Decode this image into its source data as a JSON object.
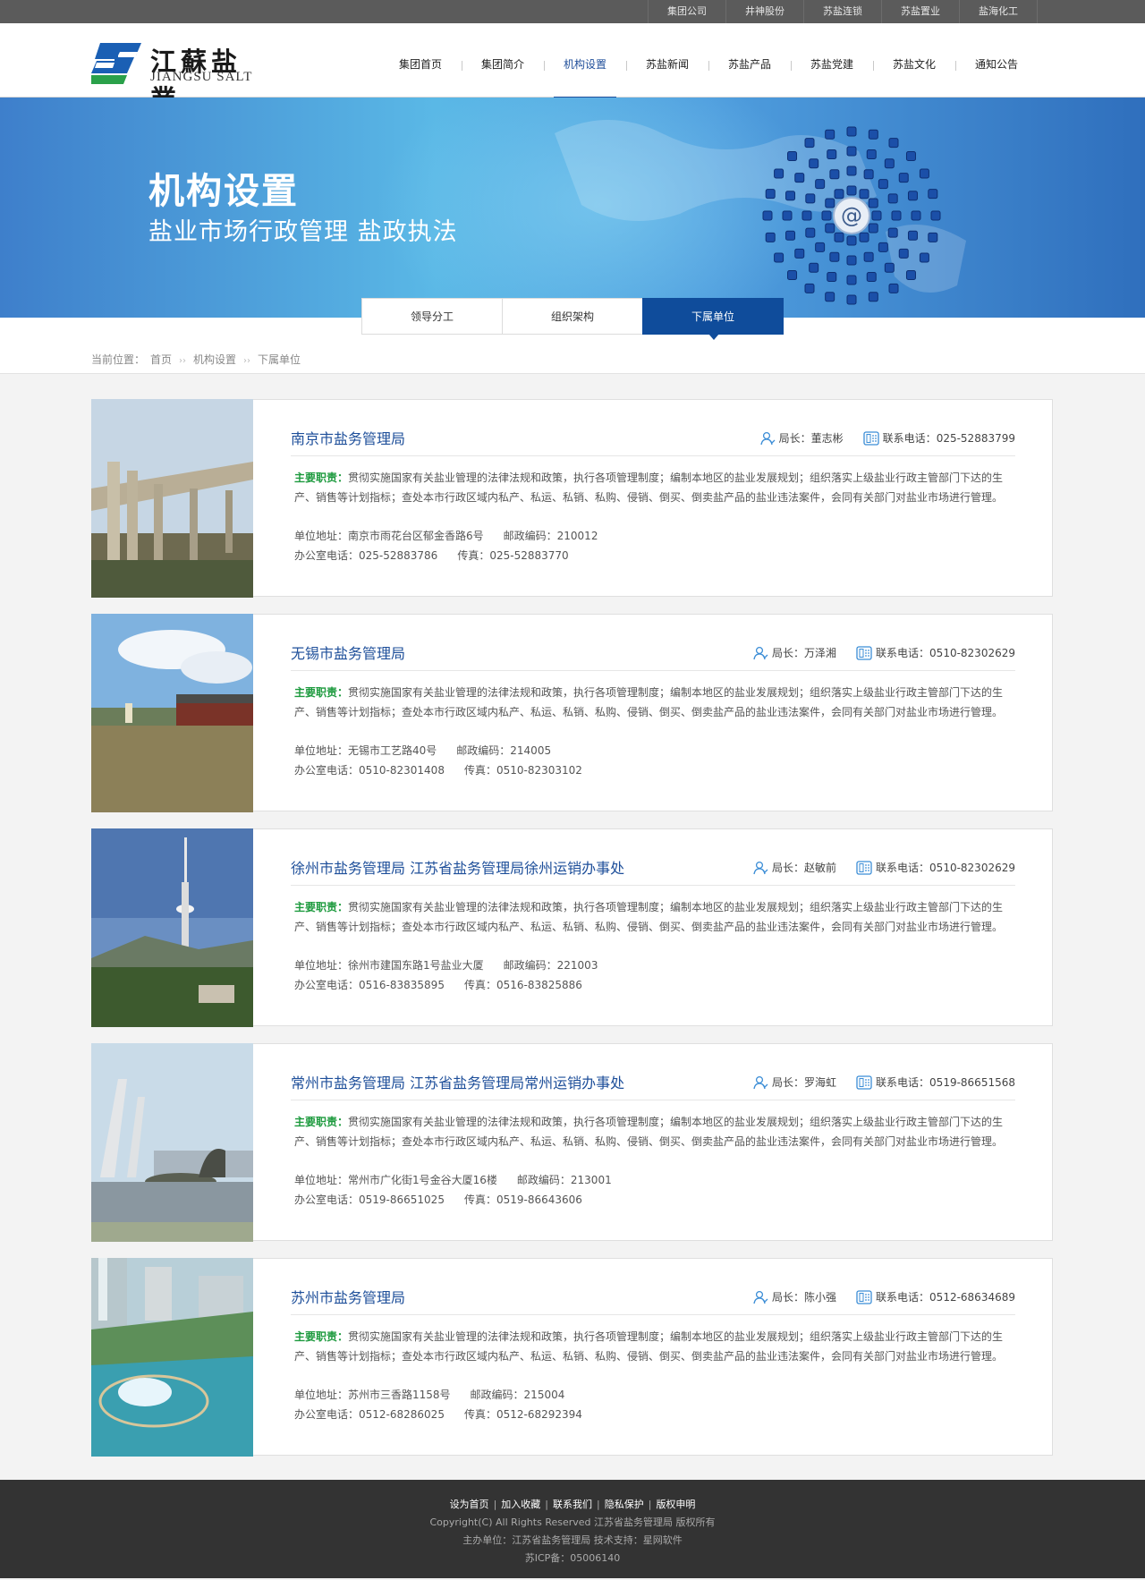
{
  "topbar": {
    "links": [
      "集团公司",
      "井神股份",
      "苏盐连锁",
      "苏盐置业",
      "盐海化工"
    ]
  },
  "logo": {
    "cn": "江蘇盐業",
    "en": "JIANGSU SALT"
  },
  "nav": {
    "items": [
      "集团首页",
      "集团简介",
      "机构设置",
      "苏盐新闻",
      "苏盐产品",
      "苏盐党建",
      "苏盐文化",
      "通知公告"
    ],
    "active_index": 2
  },
  "banner": {
    "title": "机构设置",
    "subtitle": "盐业市场行政管理   盐政执法"
  },
  "subtabs": {
    "items": [
      "领导分工",
      "组织架构",
      "下属单位"
    ],
    "active_index": 2
  },
  "breadcrumb": {
    "prefix": "当前位置：",
    "items": [
      "首页",
      "机构设置",
      "下属单位"
    ]
  },
  "units": [
    {
      "name": "南京市盐务管理局",
      "director_label": "局长：",
      "director": "董志彬",
      "phone_label": "联系电话：",
      "phone": "025-52883799",
      "duty_label": "主要职责：",
      "duty": "贯彻实施国家有关盐业管理的法律法规和政策，执行各项管理制度；编制本地区的盐业发展规划；组织落实上级盐业行政主管部门下达的生产、销售等计划指标；查处本市行政区域内私产、私运、私销、私购、侵销、倒买、倒卖盐产品的盐业违法案件，会同有关部门对盐业市场进行管理。",
      "address": "单位地址：南京市雨花台区郁金香路6号",
      "postcode": "邮政编码：210012",
      "office_phone": "办公室电话：025-52883786",
      "fax": "传真：025-52883770",
      "photo": "bridge"
    },
    {
      "name": "无锡市盐务管理局",
      "director_label": "局长：",
      "director": "万泽湘",
      "phone_label": "联系电话：",
      "phone": "0510-82302629",
      "duty_label": "主要职责：",
      "duty": "贯彻实施国家有关盐业管理的法律法规和政策，执行各项管理制度；编制本地区的盐业发展规划；组织落实上级盐业行政主管部门下达的生产、销售等计划指标；查处本市行政区域内私产、私运、私销、私购、侵销、倒买、倒卖盐产品的盐业违法案件，会同有关部门对盐业市场进行管理。",
      "address": "单位地址：无锡市工艺路40号",
      "postcode": "邮政编码：214005",
      "office_phone": "办公室电话：0510-82301408",
      "fax": "传真：0510-82303102",
      "photo": "lake"
    },
    {
      "name": "徐州市盐务管理局 江苏省盐务管理局徐州运销办事处",
      "director_label": "局长：",
      "director": "赵敏前",
      "phone_label": "联系电话：",
      "phone": "0510-82302629",
      "duty_label": "主要职责：",
      "duty": "贯彻实施国家有关盐业管理的法律法规和政策，执行各项管理制度；编制本地区的盐业发展规划；组织落实上级盐业行政主管部门下达的生产、销售等计划指标；查处本市行政区域内私产、私运、私销、私购、侵销、倒买、倒卖盐产品的盐业违法案件，会同有关部门对盐业市场进行管理。",
      "address": "单位地址：徐州市建国东路1号盐业大厦",
      "postcode": "邮政编码：221003",
      "office_phone": "办公室电话：0516-83835895",
      "fax": "传真：0516-83825886",
      "photo": "tower"
    },
    {
      "name": "常州市盐务管理局 江苏省盐务管理局常州运销办事处",
      "director_label": "局长：",
      "director": "罗海虹",
      "phone_label": "联系电话：",
      "phone": "0519-86651568",
      "duty_label": "主要职责：",
      "duty": "贯彻实施国家有关盐业管理的法律法规和政策，执行各项管理制度；编制本地区的盐业发展规划；组织落实上级盐业行政主管部门下达的生产、销售等计划指标；查处本市行政区域内私产、私运、私销、私购、侵销、倒买、倒卖盐产品的盐业违法案件，会同有关部门对盐业市场进行管理。",
      "address": "单位地址：常州市广化街1号金谷大厦16楼",
      "postcode": "邮政编码：213001",
      "office_phone": "办公室电话：0519-86651025",
      "fax": "传真：0519-86643606",
      "photo": "dino"
    },
    {
      "name": "苏州市盐务管理局",
      "director_label": "局长：",
      "director": "陈小强",
      "phone_label": "联系电话：",
      "phone": "0512-68634689",
      "duty_label": "主要职责：",
      "duty": "贯彻实施国家有关盐业管理的法律法规和政策，执行各项管理制度；编制本地区的盐业发展规划；组织落实上级盐业行政主管部门下达的生产、销售等计划指标；查处本市行政区域内私产、私运、私销、私购、侵销、倒买、倒卖盐产品的盐业违法案件，会同有关部门对盐业市场进行管理。",
      "address": "单位地址：苏州市三香路1158号",
      "postcode": "邮政编码：215004",
      "office_phone": "办公室电话：0512-68286025",
      "fax": "传真：0512-68292394",
      "photo": "gate"
    }
  ],
  "footer": {
    "links": [
      "设为首页",
      "加入收藏",
      "联系我们",
      "隐私保护",
      "版权申明"
    ],
    "copyright": "Copyright(C) All Rights Reserved 江苏省盐务管理局 版权所有",
    "sponsor": "主办单位：江苏省盐务管理局  技术支持：星网软件",
    "icp": "苏ICP备：05006140"
  },
  "colors": {
    "brand_blue": "#0f4c9b",
    "title_blue": "#1e4f9a",
    "duty_green": "#1d9a3e",
    "topbar": "#5b5b5b",
    "footer": "#333333"
  },
  "icons": {
    "director": "user-icon",
    "phone": "phone-icon"
  }
}
